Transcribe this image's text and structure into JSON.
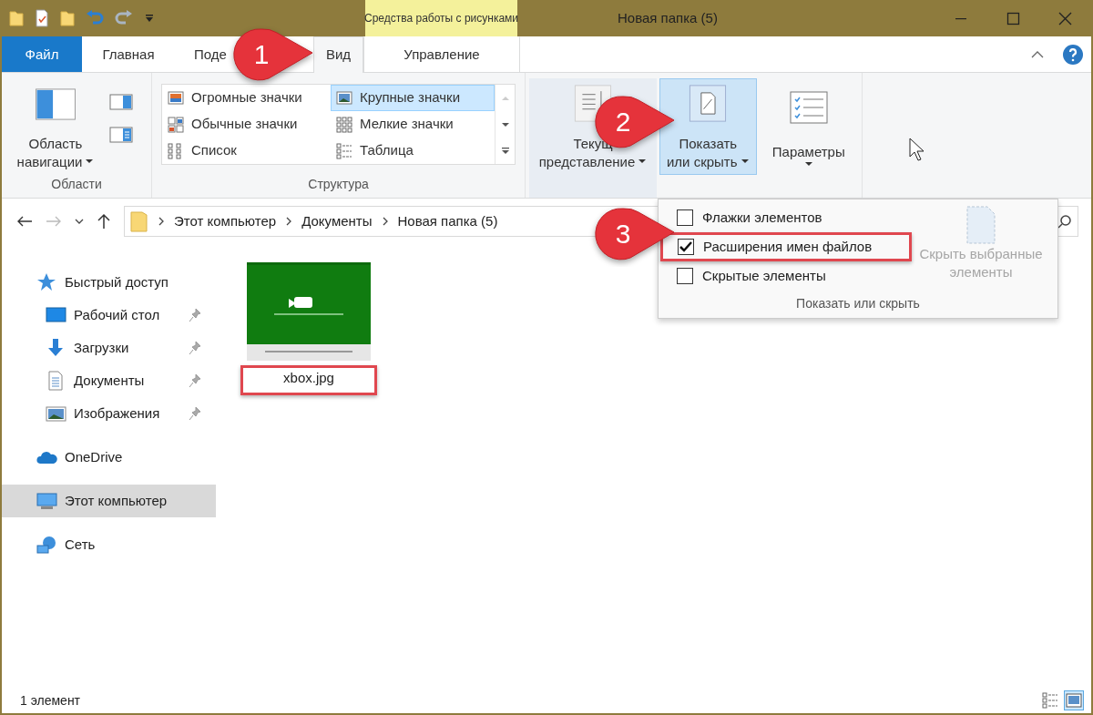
{
  "title_bar": {
    "context_tab": "Средства работы с рисунками",
    "title": "Новая папка (5)"
  },
  "tabs": [
    {
      "label": "Файл",
      "kind": "file",
      "selected": false
    },
    {
      "label": "Главная",
      "kind": "tab",
      "selected": false
    },
    {
      "label": "Поде",
      "kind": "tab",
      "selected": false
    },
    {
      "label": "Вид",
      "kind": "tab",
      "selected": true
    },
    {
      "label": "Управление",
      "kind": "context",
      "selected": false
    }
  ],
  "ribbon": {
    "areas": {
      "nav_pane": [
        "Область",
        "навигации"
      ],
      "group_label": "Области"
    },
    "layout": {
      "items": [
        {
          "label": "Огромные значки",
          "kind": "huge",
          "selected": false
        },
        {
          "label": "Крупные значки",
          "kind": "large",
          "selected": true
        },
        {
          "label": "Обычные значки",
          "kind": "medium",
          "selected": false
        },
        {
          "label": "Мелкие значки",
          "kind": "small",
          "selected": false
        },
        {
          "label": "Список",
          "kind": "list",
          "selected": false
        },
        {
          "label": "Таблица",
          "kind": "details",
          "selected": false
        }
      ],
      "group_label": "Структура"
    },
    "current_view": {
      "lines": [
        "Текущ",
        "представление"
      ],
      "pressed": false
    },
    "show_hide": {
      "lines": [
        "Показать",
        "или скрыть"
      ],
      "pressed": true
    },
    "options": {
      "lines": [
        "Параметры"
      ]
    }
  },
  "show_hide_menu": {
    "items": [
      {
        "label": "Флажки элементов",
        "checked": false,
        "highlighted": false
      },
      {
        "label": "Расширения имен файлов",
        "checked": true,
        "highlighted": true
      },
      {
        "label": "Скрытые элементы",
        "checked": false,
        "highlighted": false
      }
    ],
    "hide_selected": {
      "lines": [
        "Скрыть выбранные",
        "элементы"
      ],
      "disabled": true
    },
    "group_label": "Показать или скрыть"
  },
  "callouts": [
    "1",
    "2",
    "3"
  ],
  "address_bar": {
    "crumbs": [
      "Этот компьютер",
      "Документы",
      "Новая папка (5)"
    ]
  },
  "sidebar": {
    "items": [
      {
        "label": "Быстрый доступ",
        "kind": "star",
        "selected": false,
        "children": [
          {
            "label": "Рабочий стол",
            "kind": "desktop",
            "selected": false,
            "pinned": true
          },
          {
            "label": "Загрузки",
            "kind": "download",
            "selected": false,
            "pinned": true
          },
          {
            "label": "Документы",
            "kind": "document",
            "selected": false,
            "pinned": true
          },
          {
            "label": "Изображения",
            "kind": "pictures",
            "selected": false,
            "pinned": true
          }
        ]
      },
      {
        "label": "OneDrive",
        "kind": "cloud",
        "selected": false
      },
      {
        "label": "Этот компьютер",
        "kind": "computer",
        "selected": true
      },
      {
        "label": "Сеть",
        "kind": "network",
        "selected": false
      }
    ]
  },
  "files": [
    {
      "name": "xbox.jpg",
      "kind": "picture",
      "highlighted": true
    }
  ],
  "status_bar": {
    "text": "1 элемент",
    "views": [
      {
        "kind": "details",
        "selected": false
      },
      {
        "kind": "large",
        "selected": true
      }
    ]
  }
}
